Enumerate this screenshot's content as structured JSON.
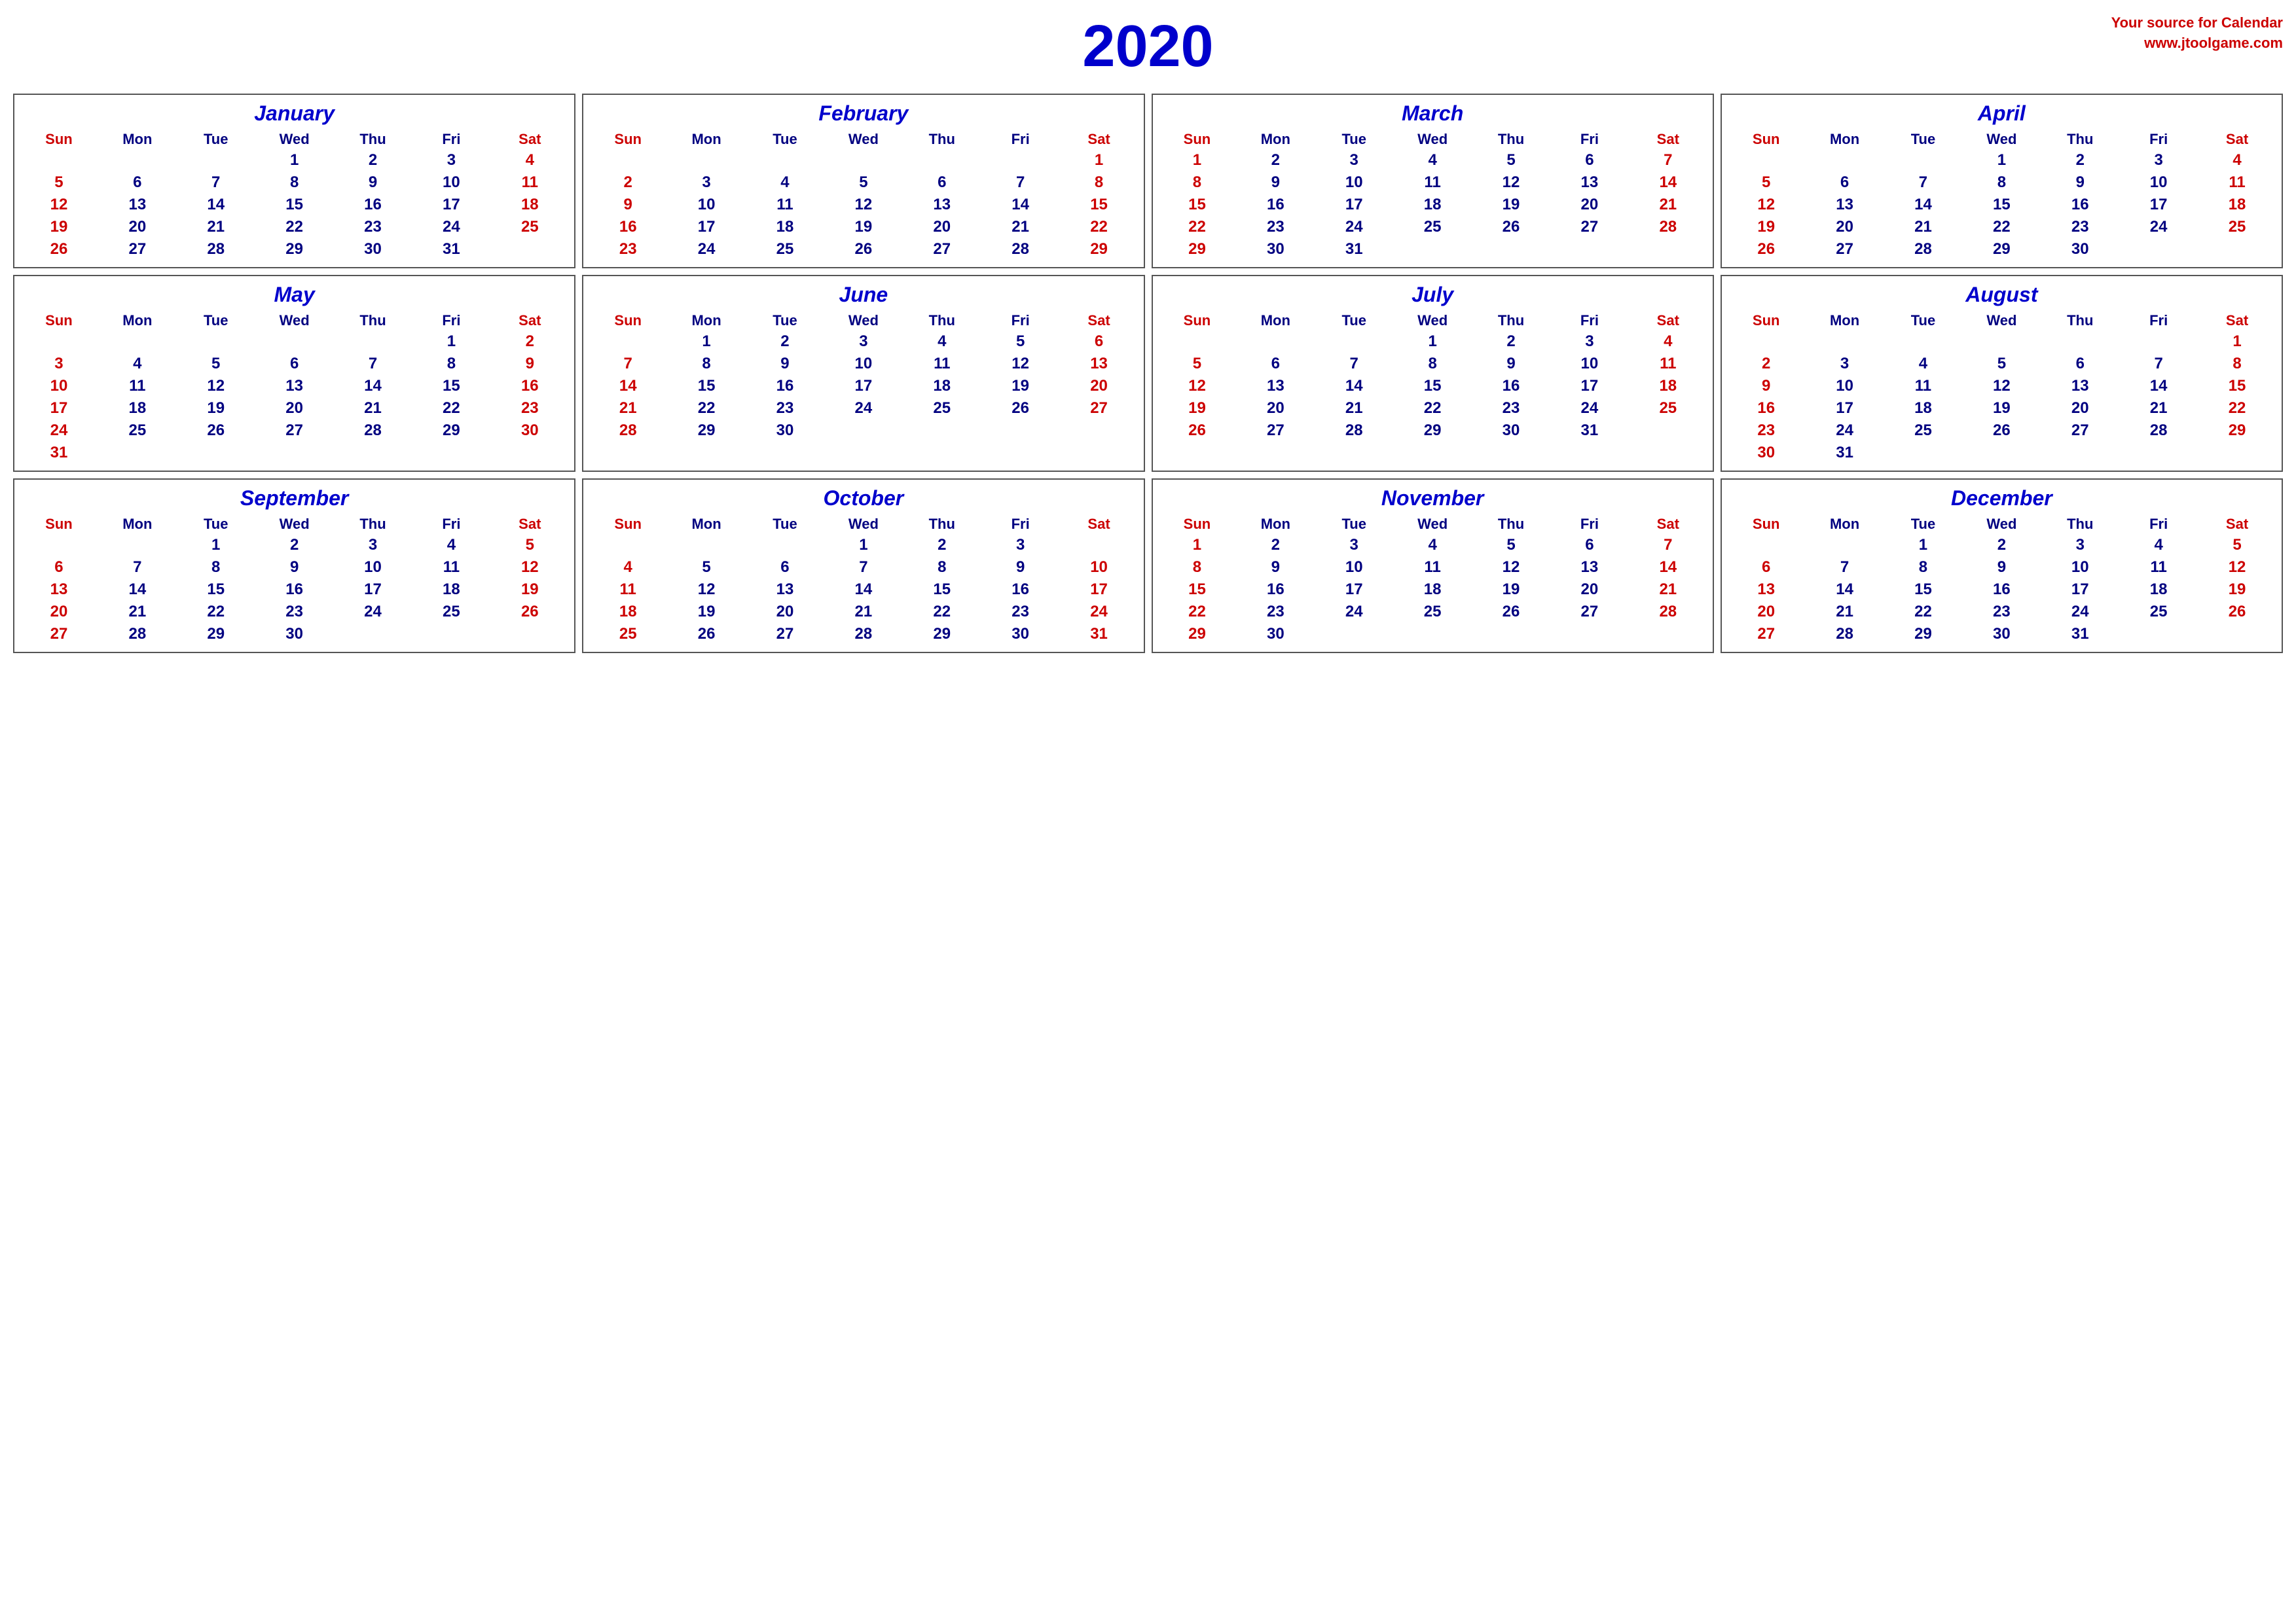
{
  "header": {
    "year": "2020",
    "source_line1": "Your source for Calendar",
    "source_line2": "www.jtoolgame.com"
  },
  "months": [
    {
      "name": "January",
      "weeks": [
        [
          "",
          "",
          "",
          "1",
          "2",
          "3",
          "4"
        ],
        [
          "5",
          "6",
          "7",
          "8",
          "9",
          "10",
          "11"
        ],
        [
          "12",
          "13",
          "14",
          "15",
          "16",
          "17",
          "18"
        ],
        [
          "19",
          "20",
          "21",
          "22",
          "23",
          "24",
          "25"
        ],
        [
          "26",
          "27",
          "28",
          "29",
          "30",
          "31",
          ""
        ]
      ]
    },
    {
      "name": "February",
      "weeks": [
        [
          "",
          "",
          "",
          "",
          "",
          "",
          "1"
        ],
        [
          "2",
          "3",
          "4",
          "5",
          "6",
          "7",
          "8"
        ],
        [
          "9",
          "10",
          "11",
          "12",
          "13",
          "14",
          "15"
        ],
        [
          "16",
          "17",
          "18",
          "19",
          "20",
          "21",
          "22"
        ],
        [
          "23",
          "24",
          "25",
          "26",
          "27",
          "28",
          "29"
        ]
      ]
    },
    {
      "name": "March",
      "weeks": [
        [
          "1",
          "2",
          "3",
          "4",
          "5",
          "6",
          "7"
        ],
        [
          "8",
          "9",
          "10",
          "11",
          "12",
          "13",
          "14"
        ],
        [
          "15",
          "16",
          "17",
          "18",
          "19",
          "20",
          "21"
        ],
        [
          "22",
          "23",
          "24",
          "25",
          "26",
          "27",
          "28"
        ],
        [
          "29",
          "30",
          "31",
          "",
          "",
          "",
          ""
        ]
      ]
    },
    {
      "name": "April",
      "weeks": [
        [
          "",
          "",
          "",
          "1",
          "2",
          "3",
          "4"
        ],
        [
          "5",
          "6",
          "7",
          "8",
          "9",
          "10",
          "11"
        ],
        [
          "12",
          "13",
          "14",
          "15",
          "16",
          "17",
          "18"
        ],
        [
          "19",
          "20",
          "21",
          "22",
          "23",
          "24",
          "25"
        ],
        [
          "26",
          "27",
          "28",
          "29",
          "30",
          "",
          ""
        ]
      ]
    },
    {
      "name": "May",
      "weeks": [
        [
          "",
          "",
          "",
          "",
          "",
          "1",
          "2"
        ],
        [
          "3",
          "4",
          "5",
          "6",
          "7",
          "8",
          "9"
        ],
        [
          "10",
          "11",
          "12",
          "13",
          "14",
          "15",
          "16"
        ],
        [
          "17",
          "18",
          "19",
          "20",
          "21",
          "22",
          "23"
        ],
        [
          "24",
          "25",
          "26",
          "27",
          "28",
          "29",
          "30"
        ],
        [
          "31",
          "",
          "",
          "",
          "",
          "",
          ""
        ]
      ]
    },
    {
      "name": "June",
      "weeks": [
        [
          "",
          "1",
          "2",
          "3",
          "4",
          "5",
          "6"
        ],
        [
          "7",
          "8",
          "9",
          "10",
          "11",
          "12",
          "13"
        ],
        [
          "14",
          "15",
          "16",
          "17",
          "18",
          "19",
          "20"
        ],
        [
          "21",
          "22",
          "23",
          "24",
          "25",
          "26",
          "27"
        ],
        [
          "28",
          "29",
          "30",
          "",
          "",
          "",
          ""
        ]
      ]
    },
    {
      "name": "July",
      "weeks": [
        [
          "",
          "",
          "",
          "1",
          "2",
          "3",
          "4"
        ],
        [
          "5",
          "6",
          "7",
          "8",
          "9",
          "10",
          "11"
        ],
        [
          "12",
          "13",
          "14",
          "15",
          "16",
          "17",
          "18"
        ],
        [
          "19",
          "20",
          "21",
          "22",
          "23",
          "24",
          "25"
        ],
        [
          "26",
          "27",
          "28",
          "29",
          "30",
          "31",
          ""
        ]
      ]
    },
    {
      "name": "August",
      "weeks": [
        [
          "",
          "",
          "",
          "",
          "",
          "",
          "1"
        ],
        [
          "2",
          "3",
          "4",
          "5",
          "6",
          "7",
          "8"
        ],
        [
          "9",
          "10",
          "11",
          "12",
          "13",
          "14",
          "15"
        ],
        [
          "16",
          "17",
          "18",
          "19",
          "20",
          "21",
          "22"
        ],
        [
          "23",
          "24",
          "25",
          "26",
          "27",
          "28",
          "29"
        ],
        [
          "30",
          "31",
          "",
          "",
          "",
          "",
          ""
        ]
      ]
    },
    {
      "name": "September",
      "weeks": [
        [
          "",
          "",
          "1",
          "2",
          "3",
          "4",
          "5"
        ],
        [
          "6",
          "7",
          "8",
          "9",
          "10",
          "11",
          "12"
        ],
        [
          "13",
          "14",
          "15",
          "16",
          "17",
          "18",
          "19"
        ],
        [
          "20",
          "21",
          "22",
          "23",
          "24",
          "25",
          "26"
        ],
        [
          "27",
          "28",
          "29",
          "30",
          "",
          "",
          ""
        ]
      ]
    },
    {
      "name": "October",
      "weeks": [
        [
          "",
          "",
          "",
          "1",
          "2",
          "3",
          ""
        ],
        [
          "4",
          "5",
          "6",
          "7",
          "8",
          "9",
          "10"
        ],
        [
          "11",
          "12",
          "13",
          "14",
          "15",
          "16",
          "17"
        ],
        [
          "18",
          "19",
          "20",
          "21",
          "22",
          "23",
          "24"
        ],
        [
          "25",
          "26",
          "27",
          "28",
          "29",
          "30",
          "31"
        ]
      ]
    },
    {
      "name": "November",
      "weeks": [
        [
          "1",
          "2",
          "3",
          "4",
          "5",
          "6",
          "7"
        ],
        [
          "8",
          "9",
          "10",
          "11",
          "12",
          "13",
          "14"
        ],
        [
          "15",
          "16",
          "17",
          "18",
          "19",
          "20",
          "21"
        ],
        [
          "22",
          "23",
          "24",
          "25",
          "26",
          "27",
          "28"
        ],
        [
          "29",
          "30",
          "",
          "",
          "",
          "",
          ""
        ]
      ]
    },
    {
      "name": "December",
      "weeks": [
        [
          "",
          "",
          "1",
          "2",
          "3",
          "4",
          "5"
        ],
        [
          "6",
          "7",
          "8",
          "9",
          "10",
          "11",
          "12"
        ],
        [
          "13",
          "14",
          "15",
          "16",
          "17",
          "18",
          "19"
        ],
        [
          "20",
          "21",
          "22",
          "23",
          "24",
          "25",
          "26"
        ],
        [
          "27",
          "28",
          "29",
          "30",
          "31",
          "",
          ""
        ]
      ]
    }
  ]
}
